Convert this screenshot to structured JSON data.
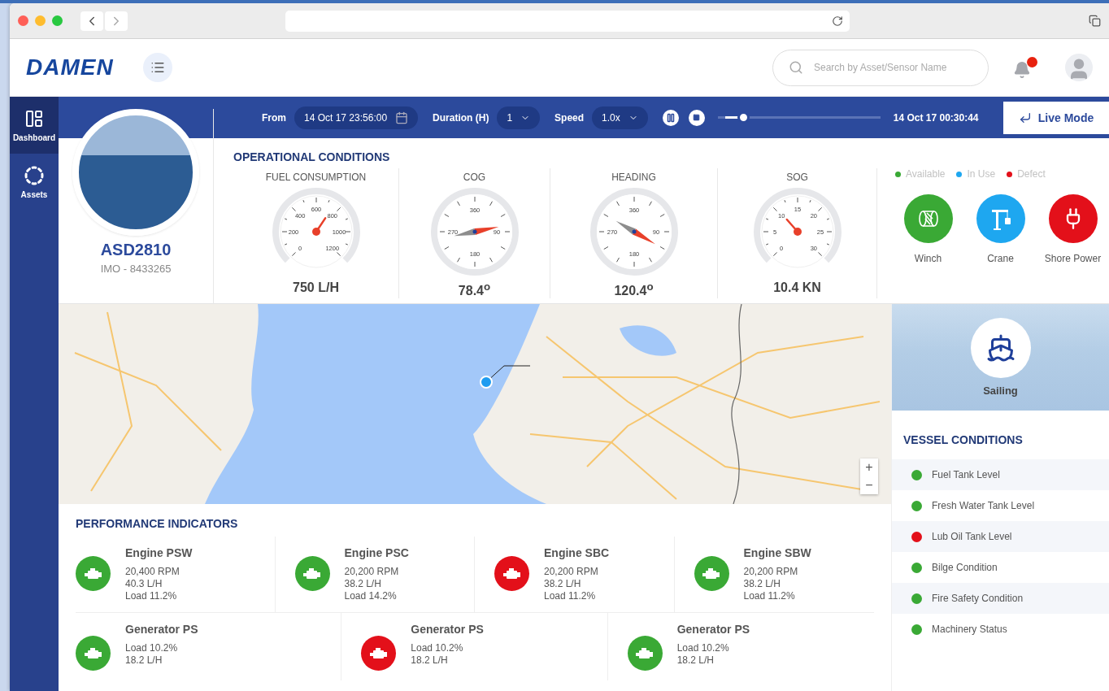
{
  "header": {
    "logo": "DAMEN",
    "search": {
      "placeholder": "Search by Asset/Sensor Name"
    },
    "notifications": {
      "unread": true
    }
  },
  "sidebar": {
    "items": [
      {
        "label": "Dashboard",
        "kind": "dashboard",
        "selected": true
      },
      {
        "label": "Assets",
        "kind": "assets",
        "selected": false
      }
    ]
  },
  "playback": {
    "from_label": "From",
    "from_value": "14 Oct 17 23:56:00",
    "duration_label": "Duration (H)",
    "duration_value": "1",
    "speed_label": "Speed",
    "speed_value": "1.0x",
    "playing": true,
    "progress": {
      "level": 0.12
    },
    "current_time": "14 Oct 17 00:30:44",
    "live_button": "Live Mode"
  },
  "vessel": {
    "name": "ASD2810",
    "imo": "IMO - 8433265"
  },
  "operational_conditions": {
    "title": "OPERATIONAL CONDITIONS",
    "gauges": [
      {
        "label": "FUEL CONSUMPTION",
        "kind": "dial",
        "ticks": [
          "0",
          "200",
          "400",
          "600",
          "800",
          "1000",
          "1200"
        ],
        "reading": "750 L/H"
      },
      {
        "label": "COG",
        "kind": "compass",
        "ticks": [
          "360",
          "90",
          "180",
          "270"
        ],
        "reading": "78.4$^{o}$"
      },
      {
        "label": "HEADING",
        "kind": "compass",
        "ticks": [
          "360",
          "90",
          "180",
          "270"
        ],
        "reading": "120.4$^{o}$"
      },
      {
        "label": "SOG",
        "kind": "dial",
        "ticks": [
          "0",
          "5",
          "10",
          "15",
          "20",
          "25",
          "30"
        ],
        "reading": "10.4 KN"
      }
    ],
    "legend": [
      {
        "label": "Available",
        "color": "#3aa935"
      },
      {
        "label": "In Use",
        "color": "#1ea7f0"
      },
      {
        "label": "Defect",
        "color": "#e3101a"
      }
    ],
    "equipment": [
      {
        "label": "Winch",
        "kind": "winch",
        "color": "#3aa935"
      },
      {
        "label": "Crane",
        "kind": "crane",
        "color": "#1ea7f0"
      },
      {
        "label": "Shore Power",
        "kind": "plug",
        "color": "#e3101a"
      }
    ]
  },
  "map": {
    "zoom_controls": [
      "+",
      "−"
    ]
  },
  "vessel_status": {
    "label": "Sailing"
  },
  "vessel_conditions": {
    "title": "VESSEL CONDITIONS",
    "items": [
      {
        "label": "Fuel Tank Level",
        "color": "#3aa935"
      },
      {
        "label": "Fresh Water Tank Level",
        "color": "#3aa935"
      },
      {
        "label": "Lub Oil Tank Level",
        "color": "#e3101a"
      },
      {
        "label": "Bilge Condition",
        "color": "#3aa935"
      },
      {
        "label": "Fire Safety Condition",
        "color": "#3aa935"
      },
      {
        "label": "Machinery Status",
        "color": "#3aa935"
      }
    ]
  },
  "performance": {
    "title": "PERFORMANCE INDICATORS",
    "engines": [
      {
        "name": "Engine PSW",
        "lines": [
          "20,400 RPM",
          "40.3 L/H",
          "Load 11.2%"
        ],
        "color": "#3aa935"
      },
      {
        "name": "Engine PSC",
        "lines": [
          "20,200 RPM",
          "38.2 L/H",
          "Load 14.2%"
        ],
        "color": "#3aa935"
      },
      {
        "name": "Engine SBC",
        "lines": [
          "20,200 RPM",
          "38.2 L/H",
          "Load 11.2%"
        ],
        "color": "#e3101a"
      },
      {
        "name": "Engine SBW",
        "lines": [
          "20,200 RPM",
          "38.2 L/H",
          "Load 11.2%"
        ],
        "color": "#3aa935"
      }
    ],
    "generators": [
      {
        "name": "Generator PS",
        "lines": [
          "Load 10.2%",
          "18.2 L/H"
        ],
        "color": "#3aa935"
      },
      {
        "name": "Generator PS",
        "lines": [
          "Load 10.2%",
          "18.2 L/H"
        ],
        "color": "#e3101a"
      },
      {
        "name": "Generator PS",
        "lines": [
          "Load 10.2%",
          "18.2 L/H"
        ],
        "color": "#3aa935"
      }
    ]
  }
}
